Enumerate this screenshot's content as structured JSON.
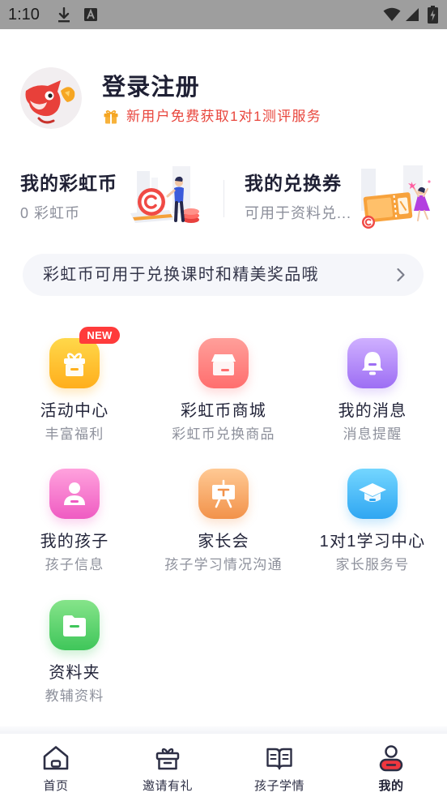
{
  "status_bar": {
    "time": "1:10",
    "icons": [
      "download-icon",
      "text-a-icon",
      "wifi-icon",
      "signal-icon",
      "battery-icon"
    ]
  },
  "profile": {
    "title": "登录注册",
    "promo": "新用户免费获取1对1测评服务",
    "avatar_icon": "fox-mascot-icon",
    "promo_icon": "gift-icon"
  },
  "wallet": {
    "coins": {
      "title": "我的彩虹币",
      "value": "0 彩虹币"
    },
    "vouchers": {
      "title": "我的兑换券",
      "desc": "可用于资料兑..."
    }
  },
  "banner": {
    "text": "彩虹币可用于兑换课时和精美奖品哦",
    "icon": "chevron-right-icon"
  },
  "menu": {
    "badge": "NEW",
    "items": [
      {
        "label": "活动中心",
        "sub": "丰富福利",
        "icon": "gift-icon",
        "color": "#ffb01c"
      },
      {
        "label": "彩虹币商城",
        "sub": "彩虹币兑换商品",
        "icon": "shop-icon",
        "color": "#ff6e6e"
      },
      {
        "label": "我的消息",
        "sub": "消息提醒",
        "icon": "bell-icon",
        "color": "#9d6ef4"
      },
      {
        "label": "我的孩子",
        "sub": "孩子信息",
        "icon": "child-icon",
        "color": "#ef5bc2"
      },
      {
        "label": "家长会",
        "sub": "孩子学习情况沟通",
        "icon": "easel-icon",
        "color": "#f2924a"
      },
      {
        "label": "1对1学习中心",
        "sub": "家长服务号",
        "icon": "graduation-cap-icon",
        "color": "#2fa6f2"
      },
      {
        "label": "资料夹",
        "sub": "教辅资料",
        "icon": "folder-icon",
        "color": "#3fc65a"
      }
    ]
  },
  "tabbar": {
    "items": [
      {
        "label": "首页",
        "icon": "home-icon",
        "active": false
      },
      {
        "label": "邀请有礼",
        "icon": "gift-box-icon",
        "active": false
      },
      {
        "label": "孩子学情",
        "icon": "book-icon",
        "active": false
      },
      {
        "label": "我的",
        "icon": "person-icon",
        "active": true
      }
    ]
  },
  "colors": {
    "accent_red": "#e8453c",
    "title": "#1f2034",
    "muted": "#8c8f9b",
    "banner_bg": "#f5f6fa",
    "status_bar": "#9e9e9e",
    "badge": "#ff3b3b"
  }
}
